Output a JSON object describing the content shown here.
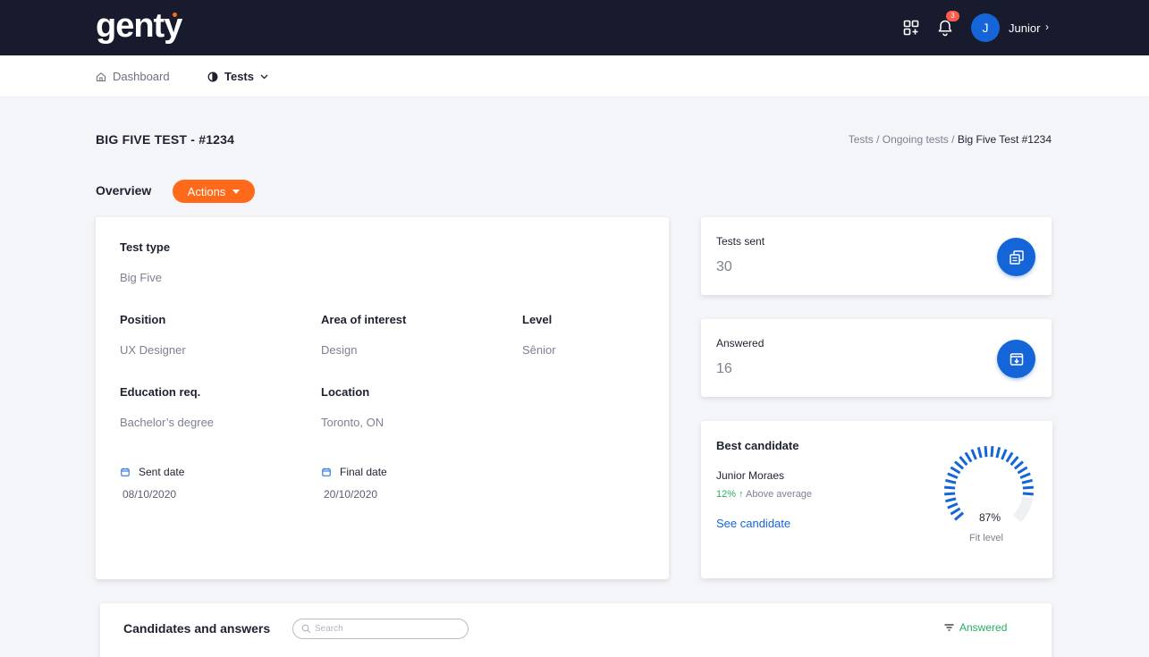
{
  "header": {
    "logo": "genty",
    "notifications_count": "3",
    "avatar_initial": "J",
    "user_name": "Junior"
  },
  "nav": {
    "dashboard": "Dashboard",
    "tests": "Tests"
  },
  "page": {
    "title": "BIG FIVE TEST - #1234",
    "breadcrumb": [
      "Tests",
      "Ongoing tests",
      "Big Five Test #1234"
    ]
  },
  "overview": {
    "label": "Overview",
    "actions_label": "Actions"
  },
  "details": {
    "test_type_label": "Test type",
    "test_type": "Big Five",
    "position_label": "Position",
    "position": "UX Designer",
    "area_label": "Area of interest",
    "area": "Design",
    "level_label": "Level",
    "level": "Sênior",
    "education_label": "Education req.",
    "education": "Bachelor’s degree",
    "location_label": "Location",
    "location": "Toronto, ON",
    "sent_date_label": "Sent date",
    "sent_date": "08/10/2020",
    "final_date_label": "Final date",
    "final_date": "20/10/2020"
  },
  "stats": {
    "tests_sent_label": "Tests sent",
    "tests_sent": "30",
    "answered_label": "Answered",
    "answered": "16"
  },
  "best_candidate": {
    "title": "Best candidate",
    "name": "Junior Moraes",
    "delta": "12%",
    "delta_text": "Above average",
    "link": "See candidate",
    "fit_percent_text": "87%",
    "fit_value": 0.87,
    "fit_label": "Fit level"
  },
  "candidates": {
    "title": "Candidates and answers",
    "search_placeholder": "Search",
    "filter_label": "Answered"
  },
  "colors": {
    "topbar": "#171b2d",
    "accent_orange": "#ff6a1a",
    "primary_blue": "#1565d8",
    "success_green": "#27ae60"
  }
}
